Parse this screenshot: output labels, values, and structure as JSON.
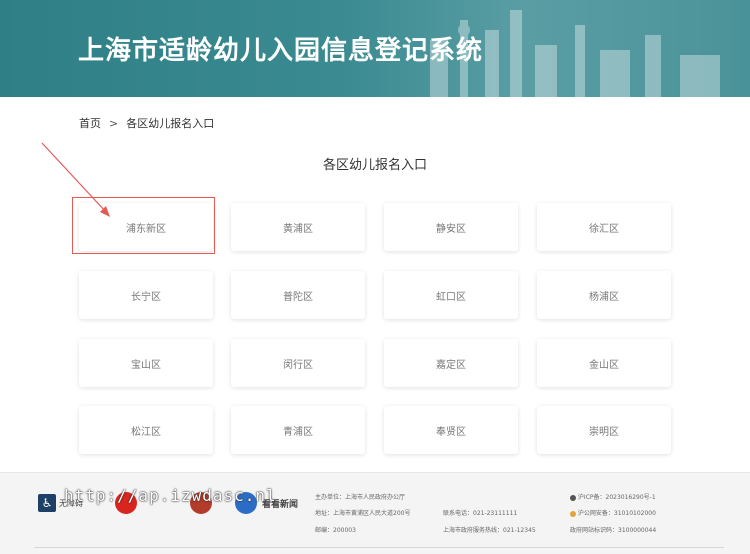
{
  "header": {
    "title": "上海市适龄幼儿入园信息登记系统"
  },
  "breadcrumb": {
    "home": "首页",
    "separator": ">",
    "current": "各区幼儿报名入口"
  },
  "section": {
    "title": "各区幼儿报名入口"
  },
  "districts": [
    "浦东新区",
    "黄浦区",
    "静安区",
    "徐汇区",
    "长宁区",
    "普陀区",
    "虹口区",
    "杨浦区",
    "宝山区",
    "闵行区",
    "嘉定区",
    "金山区",
    "松江区",
    "青浦区",
    "奉贤区",
    "崇明区"
  ],
  "footer": {
    "logos": [
      "无障碍",
      "",
      "",
      "",
      "看看新闻"
    ],
    "watermark": "http://ap.izwdasc.nl",
    "sponsor": "主办单位：上海市人民政府办公厅",
    "address": "地址：上海市黄浦区人民大道200号",
    "postcode": "邮编：200003",
    "phone": "联系电话：021-23111111",
    "hotline": "上海市政府服务热线：021-12345",
    "icp": "沪ICP备：2023016290号-1",
    "police": "沪公网安备：31010102000",
    "site_code": "政府网站标识码：3100000044"
  },
  "colors": {
    "banner": "#3a8a91",
    "highlight": "#e45a55"
  }
}
